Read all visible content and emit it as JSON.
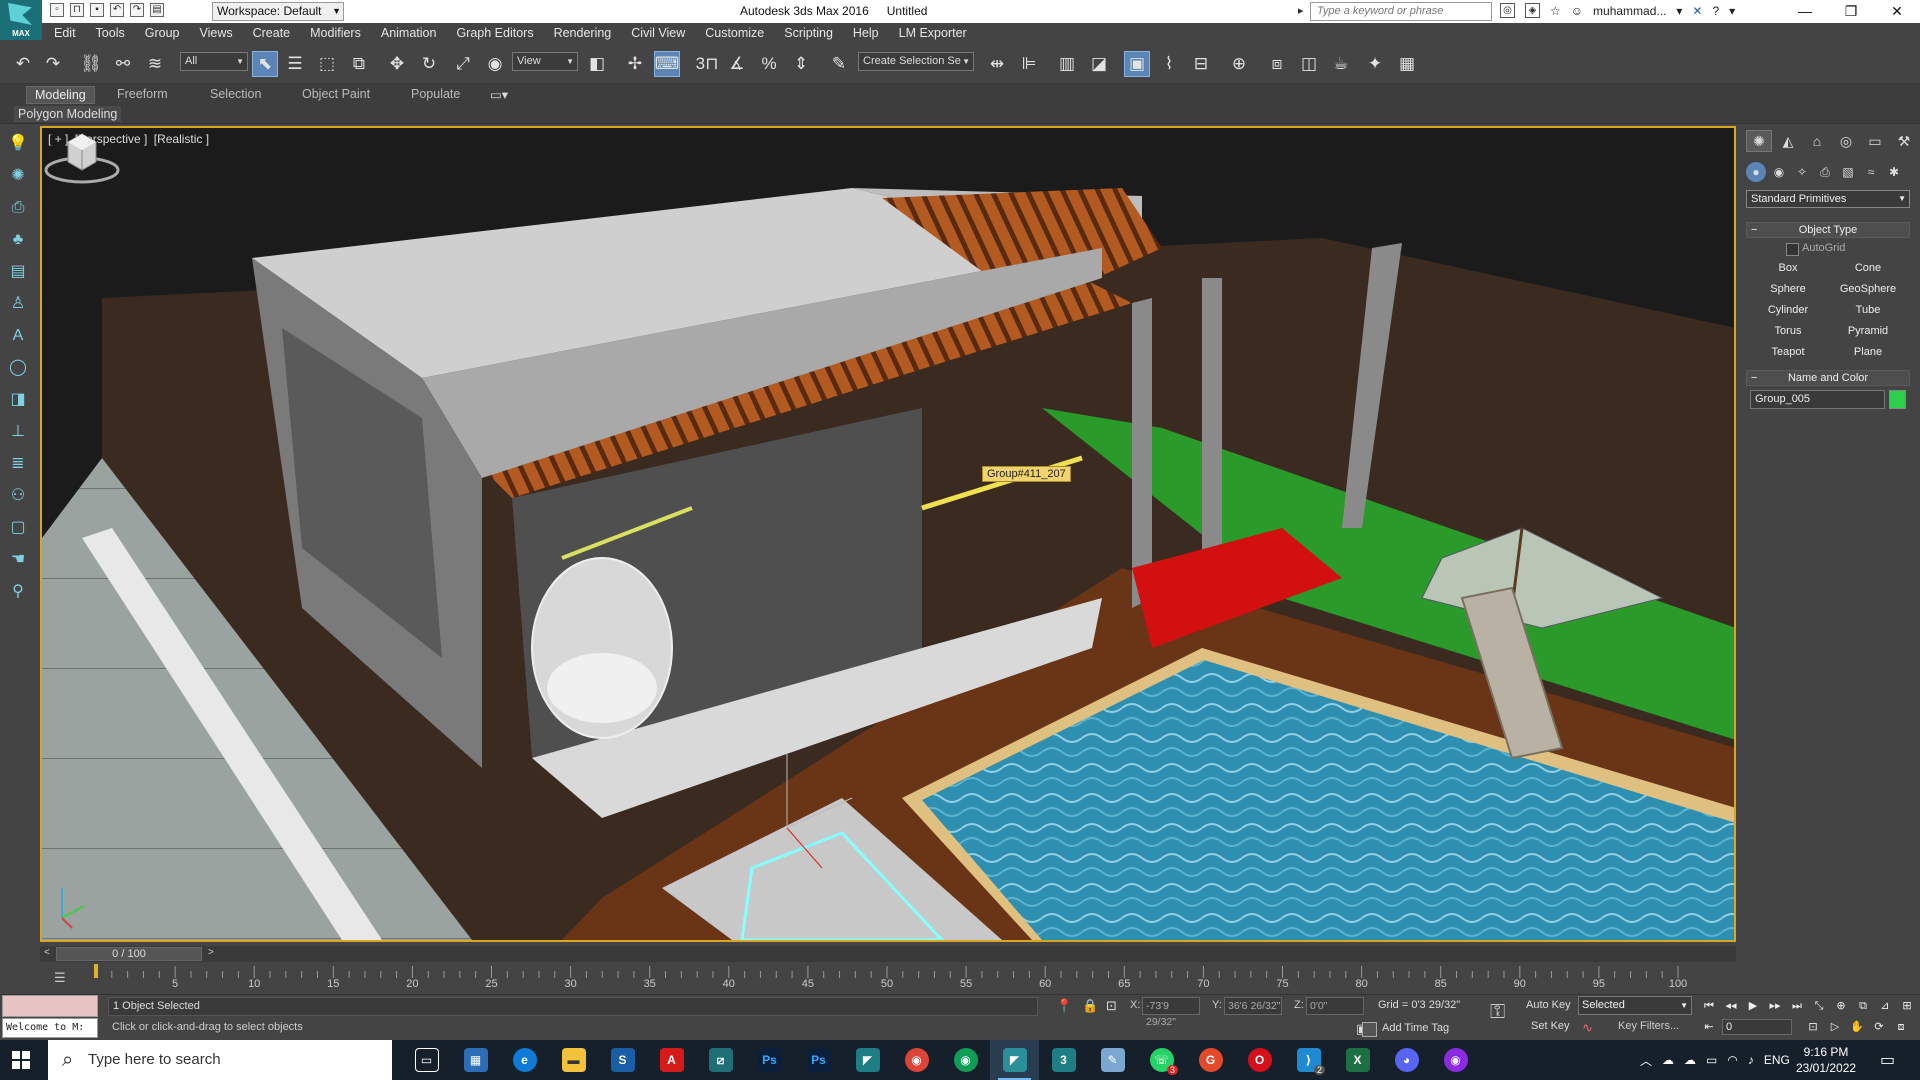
{
  "titlebar": {
    "logo_text": "MAX",
    "workspace": "Workspace: Default",
    "app_name": "Autodesk 3ds Max 2016",
    "doc_name": "Untitled",
    "search_placeholder": "Type a keyword or phrase",
    "user": "muhammad..."
  },
  "menu": [
    "Edit",
    "Tools",
    "Group",
    "Views",
    "Create",
    "Modifiers",
    "Animation",
    "Graph Editors",
    "Rendering",
    "Civil View",
    "Customize",
    "Scripting",
    "Help",
    "LM Exporter"
  ],
  "toolbar": {
    "selection_filter": "All",
    "ref_coord": "View",
    "named_selection": "Create Selection Se",
    "snap_label": "3"
  },
  "ribbon": {
    "tabs": [
      "Modeling",
      "Freeform",
      "Selection",
      "Object Paint",
      "Populate"
    ],
    "active_tab": "Modeling",
    "sub_label": "Polygon Modeling"
  },
  "viewport": {
    "labels": [
      "[ + ]",
      "[Perspective ]",
      "[Realistic ]"
    ],
    "tooltip": "Group#411_207"
  },
  "command_panel": {
    "primitive_type": "Standard Primitives",
    "object_type_title": "Object Type",
    "autogrid_label": "AutoGrid",
    "primitives": [
      "Box",
      "Cone",
      "Sphere",
      "GeoSphere",
      "Cylinder",
      "Tube",
      "Torus",
      "Pyramid",
      "Teapot",
      "Plane"
    ],
    "name_color_title": "Name and Color",
    "object_name": "Group_005",
    "object_color": "#2ecf4c"
  },
  "timeline": {
    "frame_display": "0 / 100",
    "ticks": [
      "5",
      "10",
      "15",
      "20",
      "25",
      "30",
      "35",
      "40",
      "45",
      "50",
      "55",
      "60",
      "65",
      "70",
      "75",
      "80",
      "85",
      "90",
      "95",
      "100"
    ]
  },
  "status": {
    "welcome": "Welcome to M:",
    "selection": "1 Object Selected",
    "prompt": "Click or click-and-drag to select objects",
    "x_label": "X:",
    "x_value": "-73'9 29/32\"",
    "y_label": "Y:",
    "y_value": "36'6 26/32\"",
    "z_label": "Z:",
    "z_value": "0'0\"",
    "grid": "Grid = 0'3 29/32\"",
    "add_time_tag": "Add Time Tag",
    "auto_key": "Auto Key",
    "set_key": "Set Key",
    "key_mode": "Selected",
    "key_filters": "Key Filters...",
    "current_frame": "0"
  },
  "taskbar": {
    "search_placeholder": "Type here to search",
    "apps": [
      "task-view",
      "calculator",
      "edge",
      "file-explorer",
      "sketchup",
      "acrobat",
      "autocad",
      "photoshop",
      "photoshop-2",
      "3dsmax-launcher",
      "chrome",
      "chrome-2",
      "3dsmax",
      "3dsmax-2",
      "notes",
      "whatsapp",
      "grammarly",
      "opera",
      "vscode",
      "excel",
      "discord",
      "podcast"
    ],
    "badge_whatsapp": "3",
    "badge_vscode": "2",
    "lang": "ENG",
    "time": "9:16 PM",
    "date": "23/01/2022"
  }
}
